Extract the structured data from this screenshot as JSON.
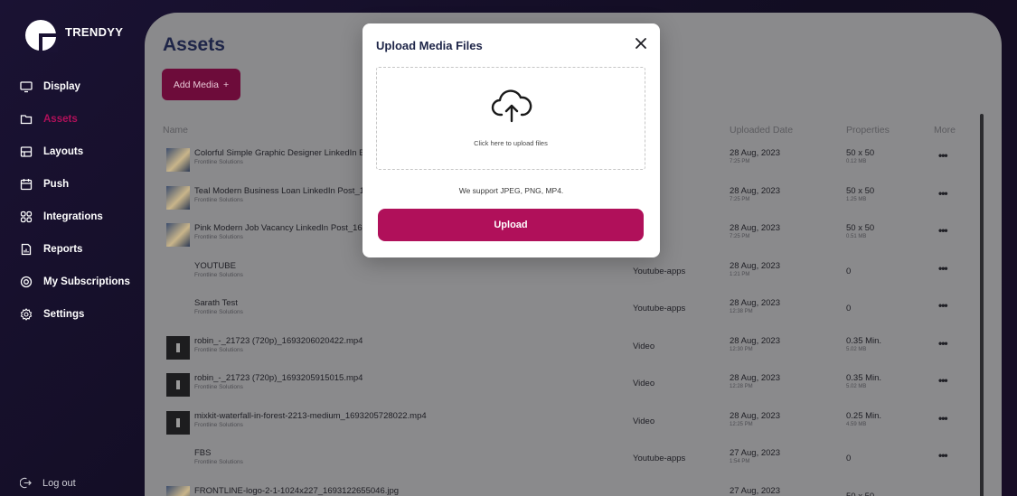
{
  "brand": {
    "name": "TRENDYY"
  },
  "sidebar": {
    "items": [
      {
        "label": "Display",
        "icon": "monitor-icon",
        "active": false
      },
      {
        "label": "Assets",
        "icon": "folder-icon",
        "active": true
      },
      {
        "label": "Layouts",
        "icon": "layout-icon",
        "active": false
      },
      {
        "label": "Push",
        "icon": "calendar-icon",
        "active": false
      },
      {
        "label": "Integrations",
        "icon": "grid-icon",
        "active": false
      },
      {
        "label": "Reports",
        "icon": "report-icon",
        "active": false
      },
      {
        "label": "My Subscriptions",
        "icon": "subscription-icon",
        "active": false
      },
      {
        "label": "Settings",
        "icon": "gear-icon",
        "active": false
      }
    ],
    "logout": "Log out"
  },
  "page": {
    "title": "Assets",
    "add_media": "Add Media",
    "add_icon": "+"
  },
  "table": {
    "headers": {
      "name": "Name",
      "uploaded": "Uploaded Date",
      "properties": "Properties",
      "more": "More"
    },
    "rows": [
      {
        "thumb": "img",
        "name": "Colorful Simple Graphic Designer LinkedIn B",
        "sub": "Frontline Solutions",
        "type": "",
        "date": "28 Aug, 2023",
        "time": "7:25 PM",
        "prop": "50 x 50",
        "size": "0.12 MB",
        "more": "•••"
      },
      {
        "thumb": "img",
        "name": "Teal Modern Business Loan LinkedIn Post_1",
        "sub": "Frontline Solutions",
        "type": "",
        "date": "28 Aug, 2023",
        "time": "7:25 PM",
        "prop": "50 x 50",
        "size": "1.25 MB",
        "more": "•••"
      },
      {
        "thumb": "img",
        "name": "Pink Modern Job Vacancy LinkedIn Post_16",
        "sub": "Frontline Solutions",
        "type": "",
        "date": "28 Aug, 2023",
        "time": "7:25 PM",
        "prop": "50 x 50",
        "size": "0.51 MB",
        "more": "•••"
      },
      {
        "thumb": "none",
        "name": "YOUTUBE",
        "sub": "Frontline Solutions",
        "type": "Youtube-apps",
        "date": "28 Aug, 2023",
        "time": "1:21 PM",
        "prop": "0",
        "size": "",
        "more": "•••"
      },
      {
        "thumb": "none",
        "name": "Sarath Test",
        "sub": "Frontline Solutions",
        "type": "Youtube-apps",
        "date": "28 Aug, 2023",
        "time": "12:38 PM",
        "prop": "0",
        "size": "",
        "more": "•••"
      },
      {
        "thumb": "vid",
        "name": "robin_-_21723 (720p)_1693206020422.mp4",
        "sub": "Frontline Solutions",
        "type": "Video",
        "date": "28 Aug, 2023",
        "time": "12:30 PM",
        "prop": "0.35 Min.",
        "size": "5.02 MB",
        "more": "•••"
      },
      {
        "thumb": "vid",
        "name": "robin_-_21723 (720p)_1693205915015.mp4",
        "sub": "Frontline Solutions",
        "type": "Video",
        "date": "28 Aug, 2023",
        "time": "12:28 PM",
        "prop": "0.35 Min.",
        "size": "5.02 MB",
        "more": "•••"
      },
      {
        "thumb": "vid",
        "name": "mixkit-waterfall-in-forest-2213-medium_1693205728022.mp4",
        "sub": "Frontline Solutions",
        "type": "Video",
        "date": "28 Aug, 2023",
        "time": "12:25 PM",
        "prop": "0.25 Min.",
        "size": "4.59 MB",
        "more": "•••"
      },
      {
        "thumb": "none",
        "name": "FBS",
        "sub": "Frontline Solutions",
        "type": "Youtube-apps",
        "date": "27 Aug, 2023",
        "time": "1:54 PM",
        "prop": "0",
        "size": "",
        "more": "•••"
      },
      {
        "thumb": "img",
        "name": "FRONTLINE-logo-2-1-1024x227_1693122655046.jpg",
        "sub": "",
        "type": "",
        "date": "27 Aug, 2023",
        "time": "",
        "prop": "50 x 50",
        "size": "",
        "more": ""
      }
    ]
  },
  "modal": {
    "title": "Upload Media Files",
    "dropzone_text": "Click here to upload files",
    "support_text": "We support JPEG, PNG, MP4.",
    "upload_button": "Upload"
  },
  "colors": {
    "accent": "#b0105a",
    "add_media_bg": "#6d0c3a",
    "title_navy": "#1e2548",
    "sidebar_bg": "#1a1233"
  }
}
